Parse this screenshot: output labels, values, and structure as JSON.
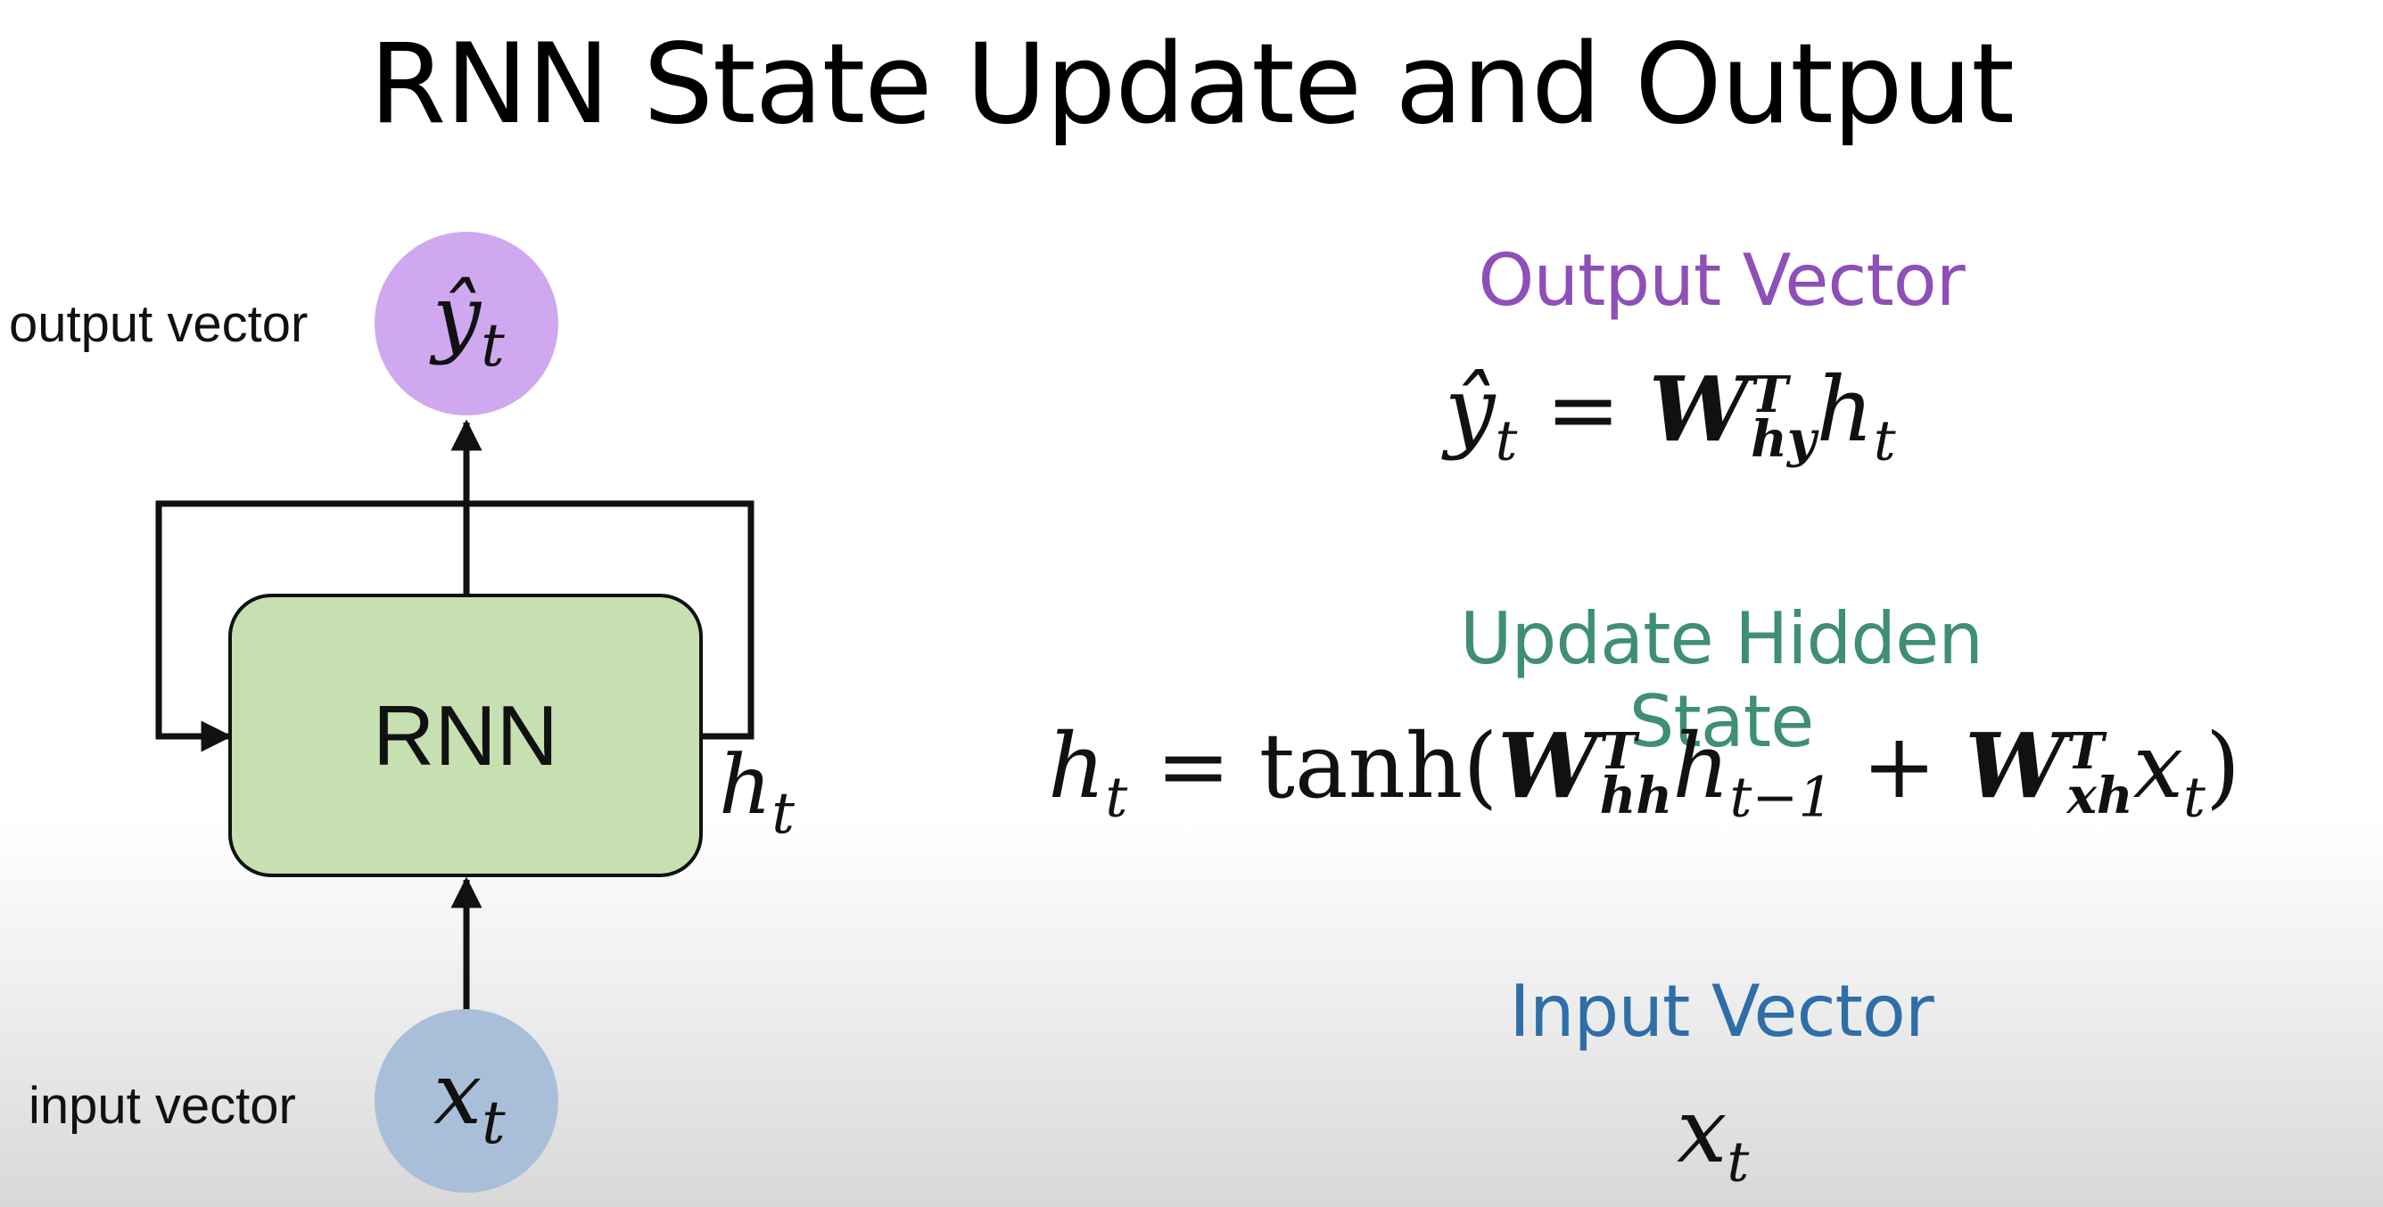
{
  "title": "RNN State Update and Output",
  "diagram": {
    "output_label": "output vector",
    "input_label": "input vector",
    "rnn_label": "RNN",
    "output_node_symbol": "ŷ",
    "input_node_symbol": "x",
    "time_subscript": "t",
    "hidden_symbol": "h",
    "colors": {
      "output_node": "#cfa8f0",
      "input_node": "#a9bfd9",
      "rnn_box": "#c6e0b2"
    }
  },
  "sections": {
    "output": {
      "heading": "Output Vector",
      "color": "#8e4fb8",
      "eq": {
        "lhs": "ŷ",
        "t": "t",
        "eq": "=",
        "W": "W",
        "T": "T",
        "sub_hy": "hy",
        "h": "h"
      }
    },
    "update": {
      "heading": "Update Hidden State",
      "color": "#3f8f72",
      "eq": {
        "h": "h",
        "t": "t",
        "eq": "=",
        "tanh": "tanh",
        "open": "(",
        "W": "W",
        "T": "T",
        "sub_hh": "hh",
        "t_minus_1": "t−1",
        "plus": "+",
        "sub_xh": "xh",
        "x": "x",
        "close": ")"
      }
    },
    "input": {
      "heading": "Input Vector",
      "color": "#2f6ea8",
      "eq": {
        "x": "x",
        "t": "t"
      }
    }
  }
}
